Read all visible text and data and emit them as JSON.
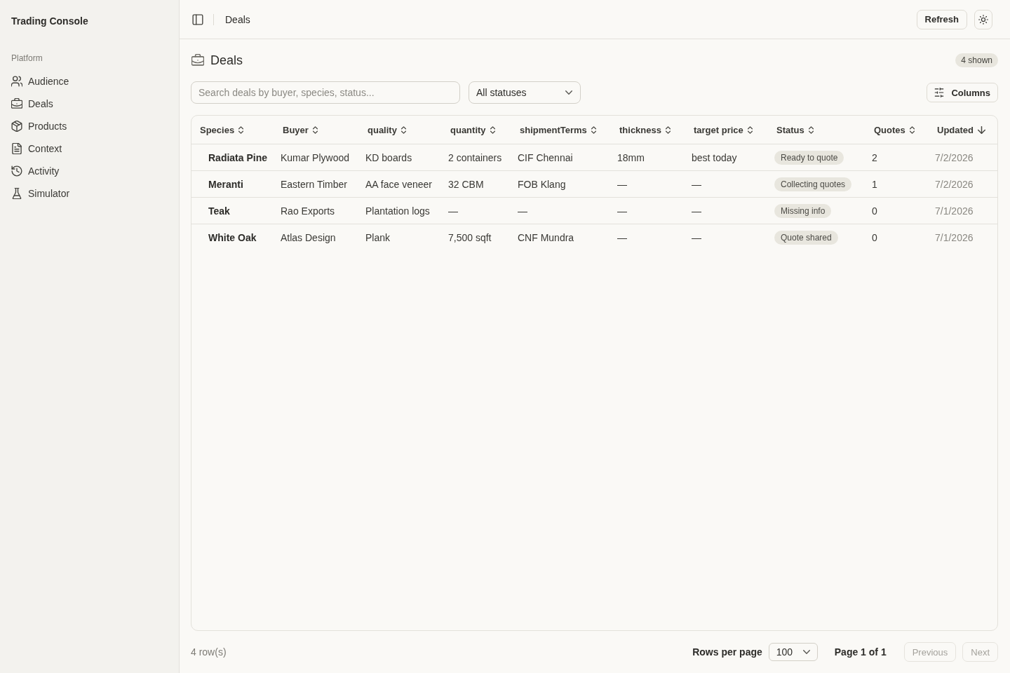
{
  "sidebar": {
    "title": "Trading Console",
    "section": "Platform",
    "items": [
      {
        "label": "Audience",
        "selected": false
      },
      {
        "label": "Deals",
        "selected": false
      },
      {
        "label": "Products",
        "selected": false
      },
      {
        "label": "Context",
        "selected": false
      },
      {
        "label": "Activity",
        "selected": false
      },
      {
        "label": "Simulator",
        "selected": false
      }
    ]
  },
  "header": {
    "breadcrumb": "Deals",
    "refresh_button": "Refresh"
  },
  "page": {
    "title": "Deals",
    "count_badge": "4 shown"
  },
  "toolbar": {
    "search": {
      "placeholder": "Search deals by buyer, species, status..."
    },
    "status_filter": {
      "value": "All statuses"
    },
    "columns_button": "Columns"
  },
  "table": {
    "columns": [
      {
        "label": "Species",
        "kind": "primary",
        "sorted": false
      },
      {
        "label": "Buyer",
        "kind": "text",
        "sorted": false
      },
      {
        "label": "quality",
        "kind": "text",
        "sorted": false
      },
      {
        "label": "quantity",
        "kind": "text",
        "sorted": false
      },
      {
        "label": "shipmentTerms",
        "kind": "text",
        "sorted": false
      },
      {
        "label": "thickness",
        "kind": "text",
        "sorted": false
      },
      {
        "label": "target price",
        "kind": "text",
        "sorted": false
      },
      {
        "label": "Status",
        "kind": "badge",
        "sorted": false
      },
      {
        "label": "Quotes",
        "kind": "text",
        "sorted": false
      },
      {
        "label": "Updated",
        "kind": "muted",
        "sorted": true
      }
    ],
    "rows": [
      {
        "cells": [
          "Radiata Pine",
          "Kumar Plywood",
          "KD boards",
          "2 containers",
          "CIF Chennai",
          "18mm",
          "best today",
          "Ready to quote",
          "2",
          "7/2/2026"
        ]
      },
      {
        "cells": [
          "Meranti",
          "Eastern Timber",
          "AA face veneer",
          "32 CBM",
          "FOB Klang",
          "—",
          "—",
          "Collecting quotes",
          "1",
          "7/2/2026"
        ]
      },
      {
        "cells": [
          "Teak",
          "Rao Exports",
          "Plantation logs",
          "—",
          "—",
          "—",
          "—",
          "Missing info",
          "0",
          "7/1/2026"
        ]
      },
      {
        "cells": [
          "White Oak",
          "Atlas Design",
          "Plank",
          "7,500 sqft",
          "CNF Mundra",
          "—",
          "—",
          "Quote shared",
          "0",
          "7/1/2026"
        ]
      }
    ]
  },
  "footer": {
    "row_count": "4 row(s)",
    "rows_per_page": {
      "label": "Rows per page",
      "value": "100"
    },
    "page_info": "Page 1 of 1",
    "buttons": [
      {
        "label": "Previous",
        "disabled": true
      },
      {
        "label": "Next",
        "disabled": true
      }
    ]
  }
}
